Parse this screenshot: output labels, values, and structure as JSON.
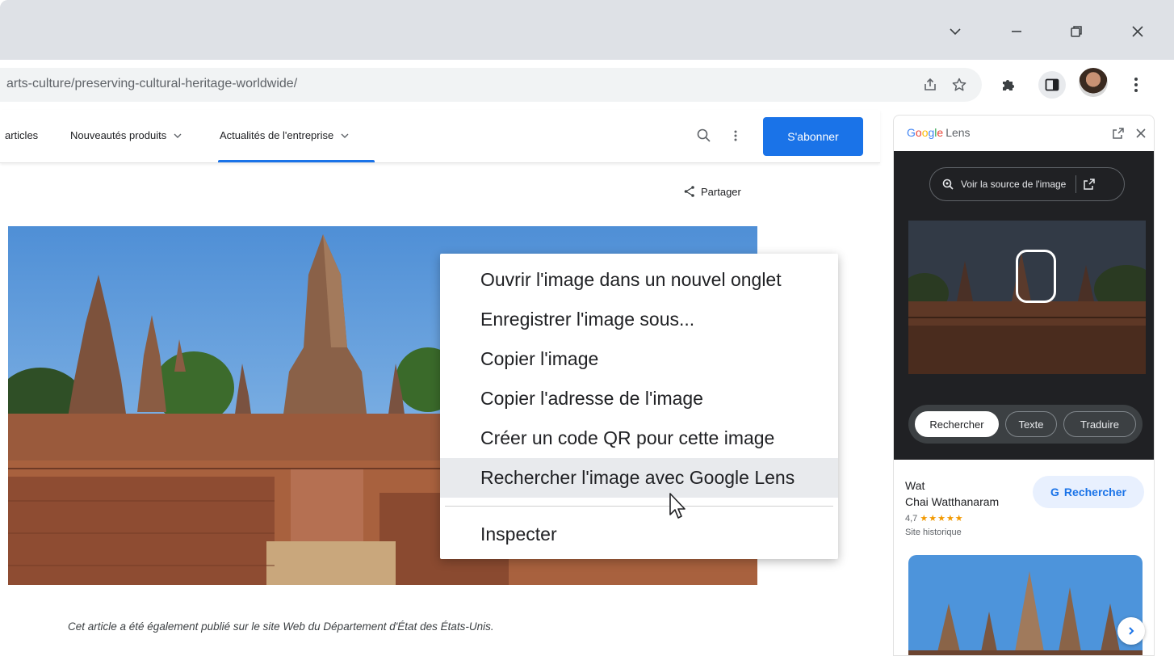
{
  "browser": {
    "url": "arts-culture/preserving-cultural-heritage-worldwide/",
    "icons": [
      "chevron-down-icon",
      "minimize-icon",
      "restore-icon",
      "close-icon",
      "share-page-icon",
      "bookmark-star-icon",
      "extensions-puzzle-icon",
      "side-panel-icon",
      "avatar",
      "more-vert-icon"
    ]
  },
  "site": {
    "nav": {
      "articles": "articles",
      "products": "Nouveautés produits",
      "company_news": "Actualités de l'entreprise"
    },
    "subscribe": "S'abonner",
    "share": "Partager",
    "caption": "Cet article a été également publié sur le site Web du Département d'État des États-Unis."
  },
  "context_menu": {
    "items": [
      "Ouvrir l'image dans un nouvel onglet",
      "Enregistrer l'image sous...",
      "Copier l'image",
      "Copier l'adresse de l'image",
      "Créer un code QR pour cette image",
      "Rechercher l'image avec Google Lens"
    ],
    "highlighted_index": 5,
    "inspect": "Inspecter"
  },
  "lens_panel": {
    "brand": "Google",
    "brand_label": "Lens",
    "source_button": "Voir la source de l'image",
    "chips": [
      "Rechercher",
      "Texte",
      "Traduire"
    ],
    "selected_chip": "Rechercher",
    "result": {
      "name_line1": "Wat",
      "name_line2": "Chai Watthanaram",
      "rating": "4,7",
      "stars": "★★★★★",
      "type": "Site historique",
      "search_label": "Rechercher",
      "search_g": "G"
    }
  },
  "colors": {
    "accent": "#1a73e8",
    "frame": "#dee1e6",
    "lens_dark": "#202124",
    "star": "#f29900"
  }
}
